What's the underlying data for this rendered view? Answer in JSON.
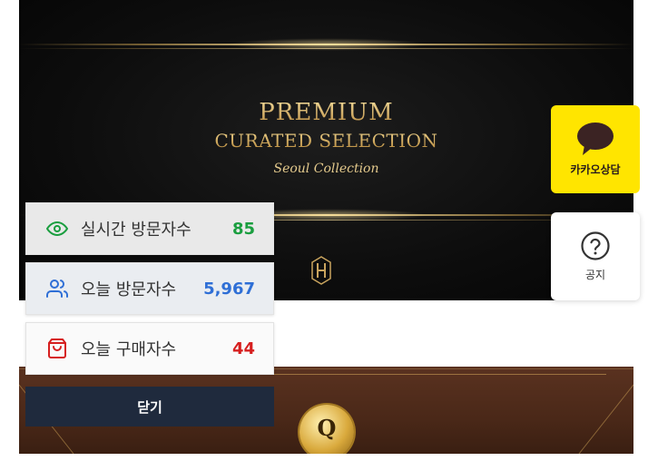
{
  "banner": {
    "title_line1": "PREMIUM",
    "title_line2": "CURATED SELECTION",
    "script_text": "Seoul Collection"
  },
  "stats": [
    {
      "label": "실시간 방문자수",
      "value": "85",
      "icon": "eye-icon",
      "color": "#1a9e3f"
    },
    {
      "label": "오늘 방문자수",
      "value": "5,967",
      "icon": "users-icon",
      "color": "#2f6fd6"
    },
    {
      "label": "오늘 구매자수",
      "value": "44",
      "icon": "shopping-bag-icon",
      "color": "#d61f1f"
    }
  ],
  "close_button": {
    "label": "닫기"
  },
  "side_buttons": {
    "kakao": {
      "label": "카카오상담",
      "icon": "speech-bubble-icon",
      "color": "#ffe500"
    },
    "notice": {
      "label": "공지",
      "icon": "question-circle-icon"
    }
  },
  "badge": {
    "letter": "Q"
  }
}
